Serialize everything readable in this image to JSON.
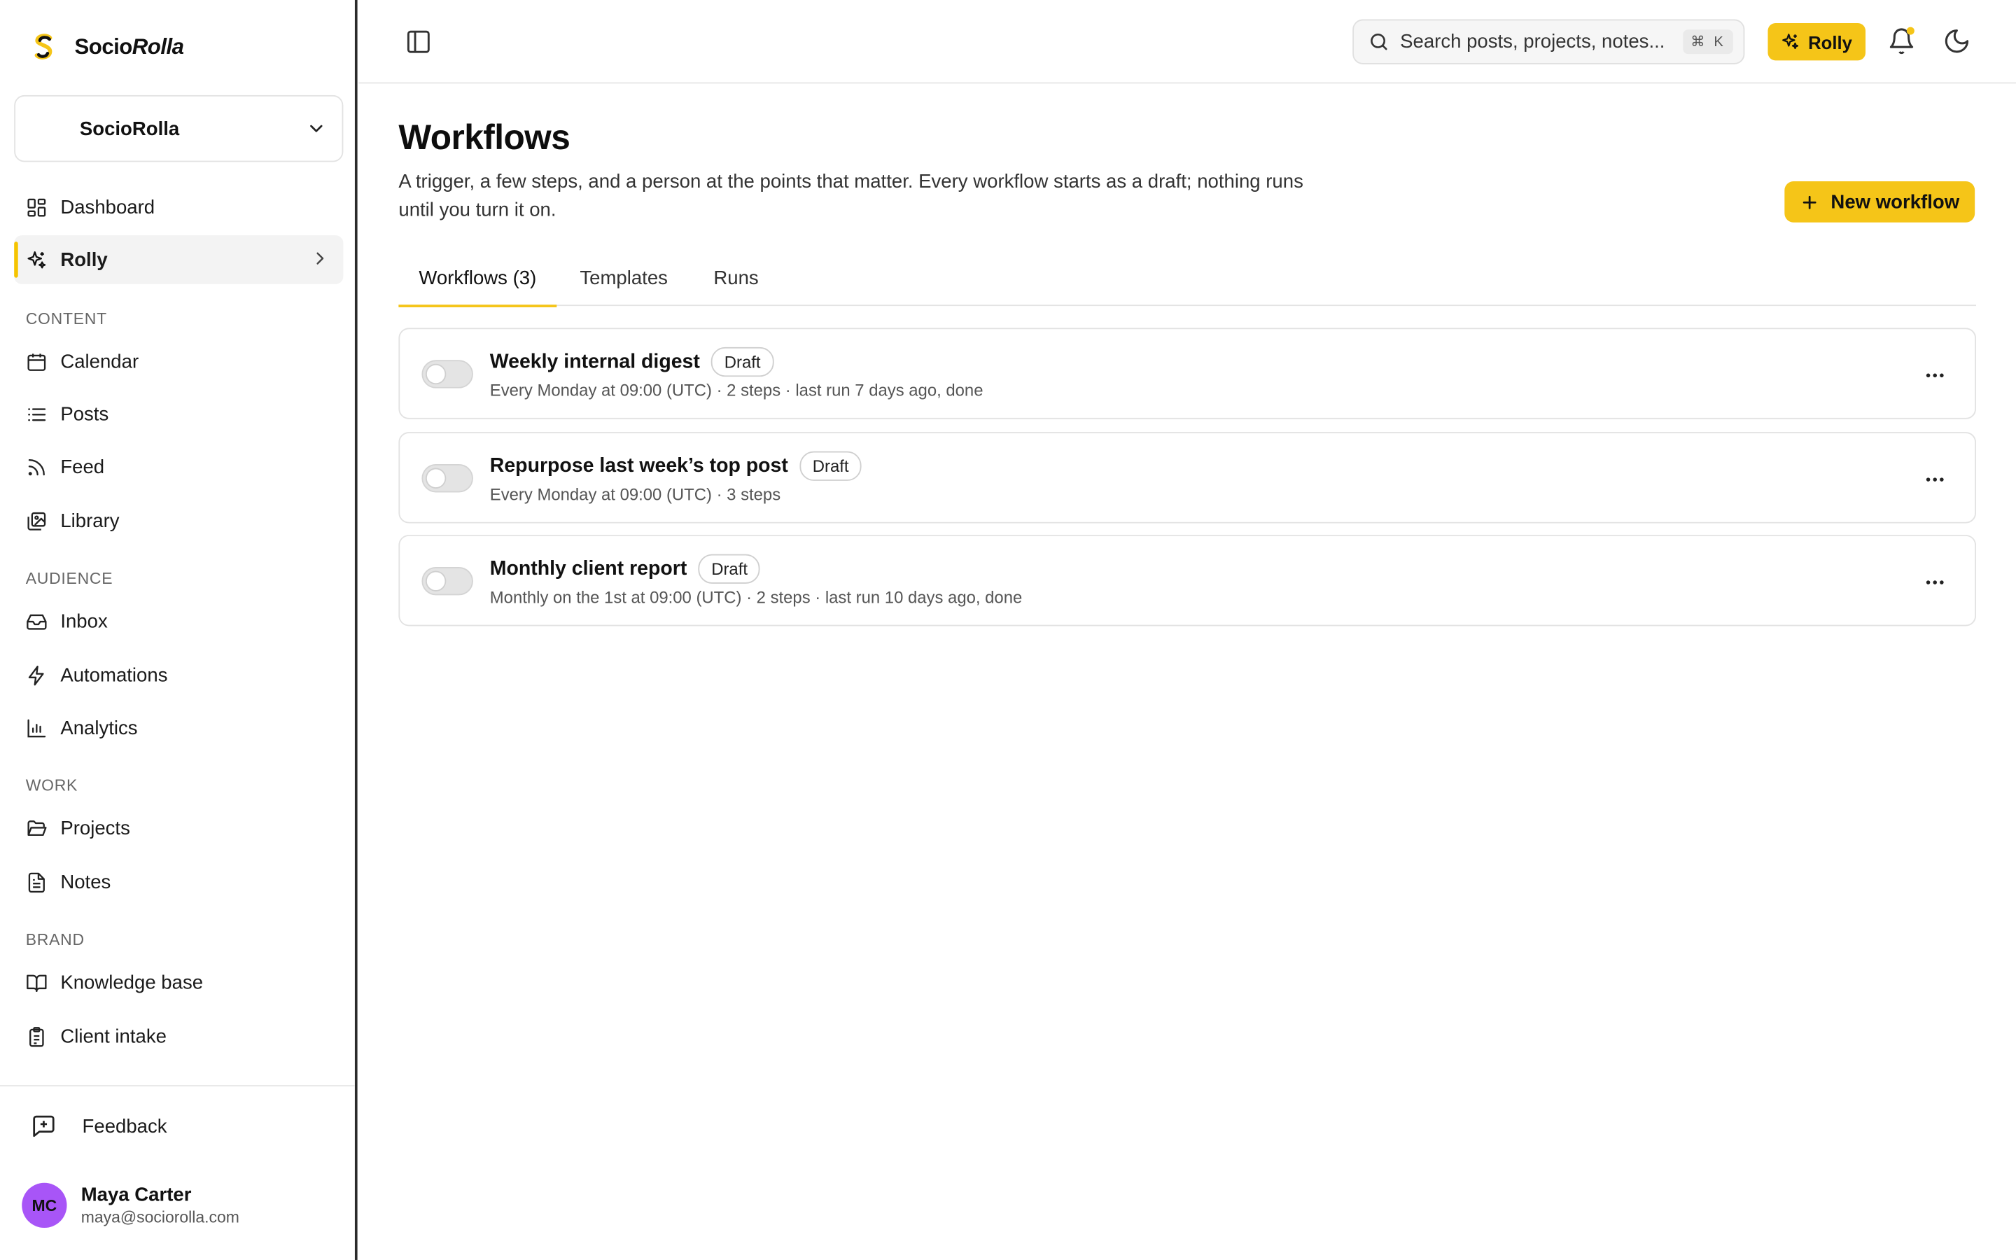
{
  "brand": {
    "name_regular": "Socio",
    "name_italic": "Rolla"
  },
  "workspace": {
    "name": "SocioRolla"
  },
  "nav": {
    "dashboard": "Dashboard",
    "rolly": "Rolly",
    "section_content": "CONTENT",
    "calendar": "Calendar",
    "posts": "Posts",
    "feed": "Feed",
    "library": "Library",
    "section_audience": "AUDIENCE",
    "inbox": "Inbox",
    "automations": "Automations",
    "analytics": "Analytics",
    "section_work": "WORK",
    "projects": "Projects",
    "notes": "Notes",
    "section_brand": "BRAND",
    "knowledge_base": "Knowledge base",
    "client_intake": "Client intake"
  },
  "feedback": {
    "label": "Feedback"
  },
  "user": {
    "initials": "MC",
    "name": "Maya Carter",
    "email": "maya@sociorolla.com"
  },
  "topbar": {
    "search_placeholder": "Search posts, projects, notes...",
    "search_shortcut": "⌘ K",
    "rolly_label": "Rolly"
  },
  "page": {
    "title": "Workflows",
    "description": "A trigger, a few steps, and a person at the points that matter. Every workflow starts as a draft; nothing runs until you turn it on.",
    "new_button": "New workflow"
  },
  "tabs": [
    {
      "label": "Workflows (3)",
      "active": true
    },
    {
      "label": "Templates",
      "active": false
    },
    {
      "label": "Runs",
      "active": false
    }
  ],
  "workflows": [
    {
      "name": "Weekly internal digest",
      "status": "Draft",
      "meta": "Every Monday at 09:00 (UTC) · 2 steps · last run 7 days ago, done",
      "enabled": false
    },
    {
      "name": "Repurpose last week’s top post",
      "status": "Draft",
      "meta": "Every Monday at 09:00 (UTC) · 3 steps",
      "enabled": false
    },
    {
      "name": "Monthly client report",
      "status": "Draft",
      "meta": "Monthly on the 1st at 09:00 (UTC) · 2 steps · last run 10 days ago, done",
      "enabled": false
    }
  ],
  "colors": {
    "accent": "#f5c518",
    "avatar": "#a855f7"
  }
}
